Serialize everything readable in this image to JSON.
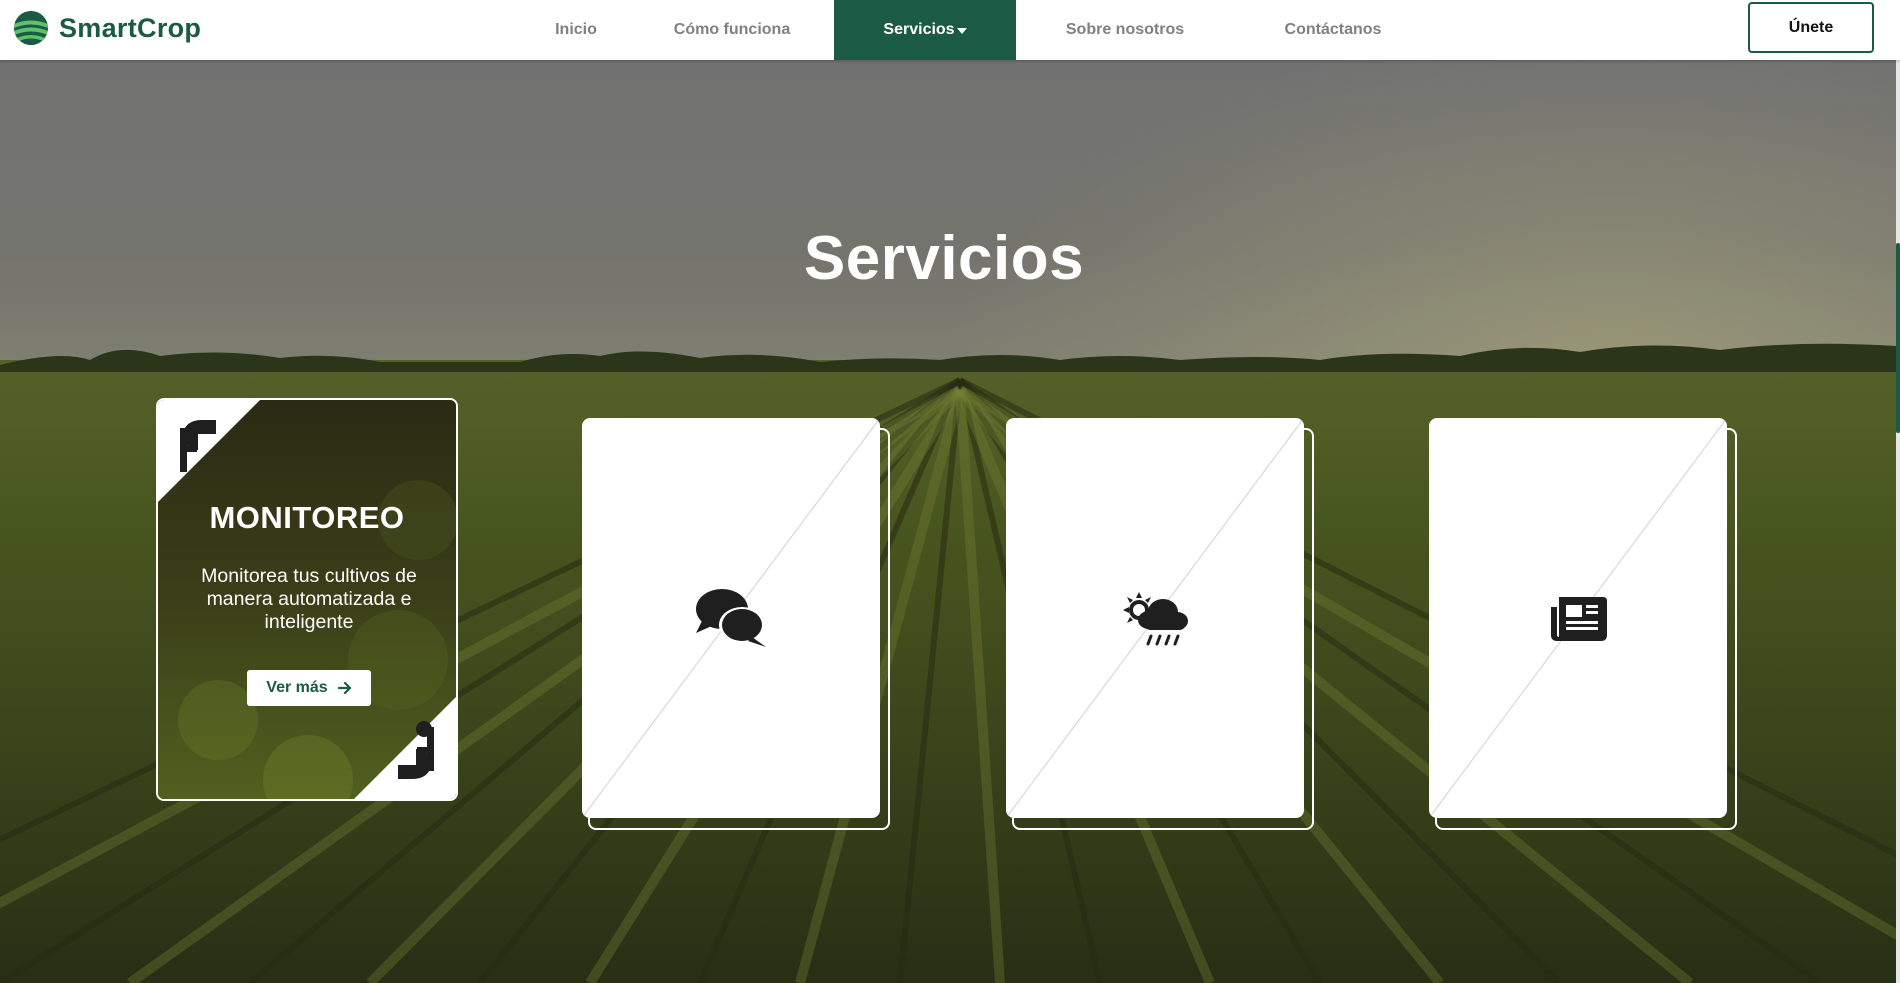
{
  "brand": {
    "name": "SmartCrop",
    "color": "#1b5a44"
  },
  "nav": {
    "items": [
      {
        "label": "Inicio"
      },
      {
        "label": "Cómo funciona"
      },
      {
        "label": "Servicios",
        "active": true
      },
      {
        "label": "Sobre nosotros"
      },
      {
        "label": "Contáctanos"
      }
    ],
    "join_label": "Únete"
  },
  "hero": {
    "title": "Servicios"
  },
  "services": {
    "featured": {
      "title": "MONITOREO",
      "description": "Monitorea tus cultivos de manera automatizada e inteligente",
      "button_label": "Ver más",
      "icon": "factory-icon"
    },
    "cards": [
      {
        "icon": "comments-icon"
      },
      {
        "icon": "weather-icon"
      },
      {
        "icon": "newspaper-icon"
      }
    ]
  }
}
